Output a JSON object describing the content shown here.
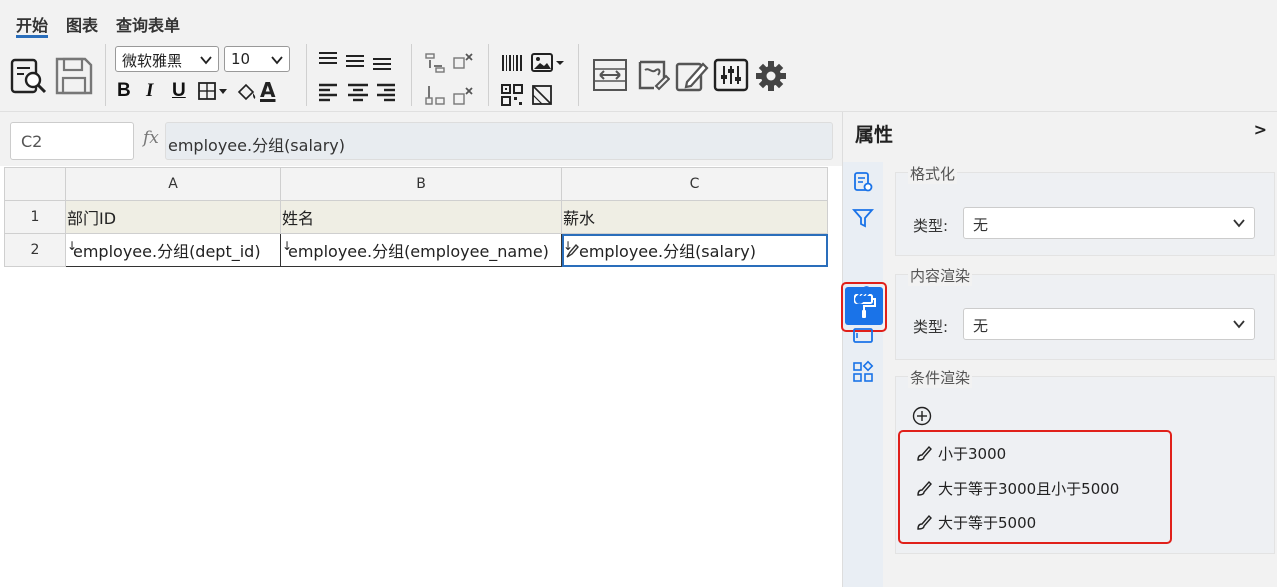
{
  "menu": {
    "tabs": [
      {
        "label": "开始"
      },
      {
        "label": "图表"
      },
      {
        "label": "查询表单"
      }
    ]
  },
  "toolbar": {
    "font_family": "微软雅黑",
    "font_size": "10",
    "bold": "B",
    "italic": "I",
    "underline": "U",
    "font_color": "A"
  },
  "formula_bar": {
    "cell_ref": "C2",
    "fx": "fx",
    "formula": "employee.分组(salary)"
  },
  "grid": {
    "columns": [
      "A",
      "B",
      "C"
    ],
    "rows": [
      {
        "num": "1",
        "cells": [
          "部门ID",
          "姓名",
          "薪水"
        ]
      },
      {
        "num": "2",
        "cells": [
          "employee.分组(dept_id)",
          "employee.分组(employee_name)",
          "employee.分组(salary)"
        ]
      }
    ]
  },
  "panel": {
    "title": "属性",
    "collapse": ">",
    "format": {
      "title": "格式化",
      "type_label": "类型:",
      "type_value": "无"
    },
    "content_render": {
      "title": "内容渲染",
      "type_label": "类型:",
      "type_value": "无"
    },
    "conditional_render": {
      "title": "条件渲染",
      "rules": [
        {
          "label": "小于3000"
        },
        {
          "label": "大于等于3000且小于5000"
        },
        {
          "label": "大于等于5000"
        }
      ]
    }
  },
  "colors": {
    "accent": "#1a73e8",
    "highlight": "#e0201a",
    "header_fill": "#efeee4"
  }
}
